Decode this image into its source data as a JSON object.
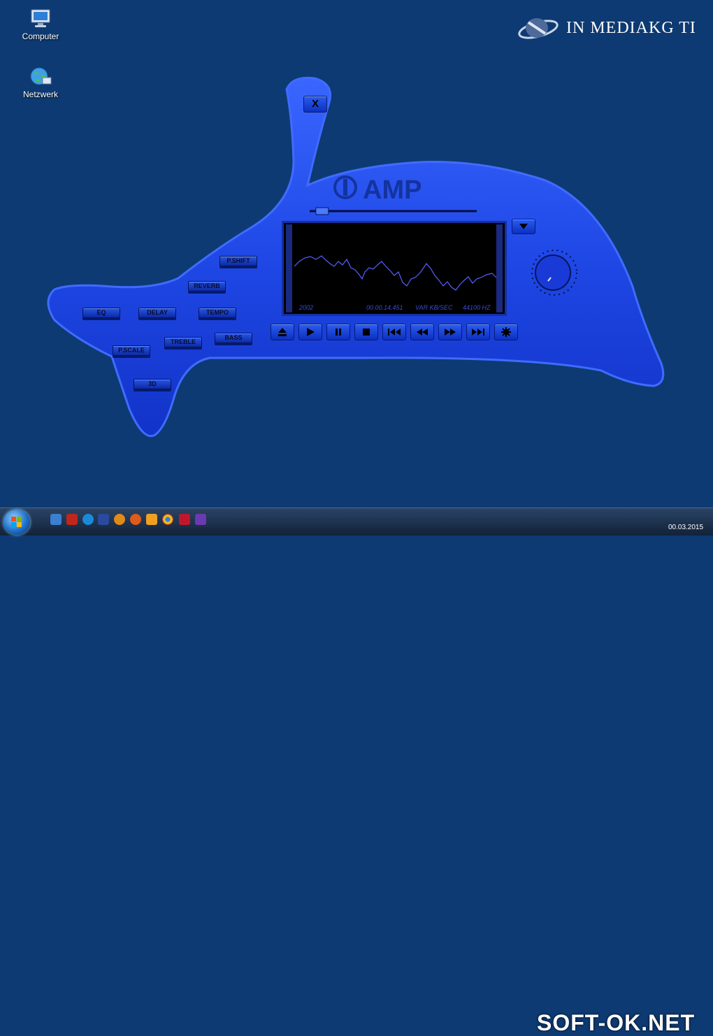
{
  "desktop": {
    "icons": [
      {
        "label": "Computer"
      },
      {
        "label": "Netzwerk"
      }
    ],
    "brand": "IN MEDIAKG TI"
  },
  "player": {
    "logo": "AMP",
    "close_label": "X",
    "effect_buttons": {
      "pshift": "P.SHIFT",
      "reverb": "REVERB",
      "eq": "EQ",
      "delay": "DELAY",
      "tempo": "TEMPO",
      "treble": "TREBLE",
      "bass": "BASS",
      "pscale": "P.SCALE",
      "threed": "3D"
    },
    "display": {
      "year": "2002",
      "time": "00.00.14.451",
      "bitrate": "VAR KB/SEC",
      "rate": "44100 HZ"
    },
    "seek_progress": 0.04,
    "colors": {
      "body": "#1f48e6",
      "screen": "#000000",
      "wave": "#5560ff"
    }
  },
  "taskbar": {
    "watermark": "SOFT-OK.NET",
    "clock_date": "00.03.2015"
  }
}
